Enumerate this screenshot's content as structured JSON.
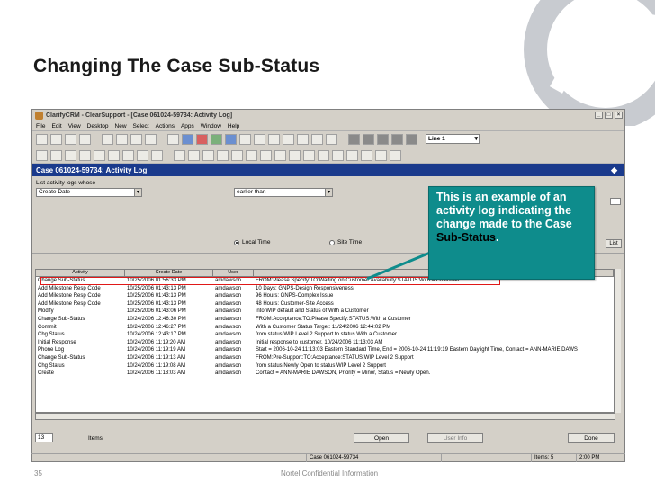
{
  "slide": {
    "title": "Changing The Case Sub-Status",
    "page_number": "35",
    "footer": "Nortel Confidential Information"
  },
  "window": {
    "title": "ClarifyCRM - ClearSupport - [Case 061024-59734: Activity Log]",
    "menu": [
      "File",
      "Edit",
      "View",
      "Desktop",
      "New",
      "Select",
      "Actions",
      "Apps",
      "Window",
      "Help"
    ],
    "line_select": "Line 1"
  },
  "case_header": "Case 061024-59734: Activity Log",
  "form": {
    "list_label": "List activity logs whose",
    "field_value": "Create Date",
    "operator_value": "earlier than",
    "local_time": "Local Time",
    "site_time": "Site Time",
    "list_button": "List"
  },
  "grid": {
    "headers": [
      "Activity",
      "Create Date",
      "User",
      ""
    ],
    "rows": [
      [
        "Change Sub-Status",
        "10/25/2006 01:56:33 PM",
        "amdawson",
        "FROM:Please Specify:TO:Waiting on Customer Availability:STATUS:With a Customer"
      ],
      [
        "Add Milestone Resp Code",
        "10/25/2006 01:43:13 PM",
        "amdawson",
        "10 Days: GNPS-Design Responsiveness"
      ],
      [
        "Add Milestone Resp Code",
        "10/25/2006 01:43:13 PM",
        "amdawson",
        "96 Hours: GNPS-Complex Issue"
      ],
      [
        "Add Milestone Resp Code",
        "10/25/2006 01:43:13 PM",
        "amdawson",
        "48 Hours: Customer-Site Access"
      ],
      [
        "Modify",
        "10/25/2006 01:43:06 PM",
        "amdawson",
        "into WIP default and Status of With a Customer"
      ],
      [
        "Change Sub-Status",
        "10/24/2006 12:46:30 PM",
        "amdawson",
        "FROM:Acceptance:TO:Please Specify:STATUS:With a Customer"
      ],
      [
        "Commit",
        "10/24/2006 12:46:27 PM",
        "amdawson",
        "With a Customer Status Target: 11/24/2006 12:44:02 PM"
      ],
      [
        "Chg Status",
        "10/24/2006 12:43:17 PM",
        "amdawson",
        "from status WIP Level 2 Support to status With a Customer"
      ],
      [
        "Initial Response",
        "10/24/2006 11:19:20 AM",
        "amdawson",
        "Initial response to customer. 10/24/2006 11:13:03 AM"
      ],
      [
        "Phone Log",
        "10/24/2006 11:19:19 AM",
        "amdawson",
        "Start = 2006-10-24 11:13:03 Eastern Standard Time, End = 2006-10-24 11:19:19 Eastern Daylight Time, Contact = ANN-MARIE DAWS"
      ],
      [
        "Change Sub-Status",
        "10/24/2006 11:19:13 AM",
        "amdawson",
        "FROM:Pre-Support:TO:Acceptance:STATUS:WIP Level 2 Support"
      ],
      [
        "Chg Status",
        "10/24/2006 11:19:08 AM",
        "amdawson",
        "from status Newly Open to status WIP Level 2 Support"
      ],
      [
        "Create",
        "10/24/2006 11:13:03 AM",
        "amdawson",
        "Contact = ANN-MARIE DAWSON, Priority = Minor, Status = Newly Open."
      ]
    ]
  },
  "bottom": {
    "items_count": "13",
    "items_label": "Items",
    "open_button": "Open",
    "user_info_button": "User Info",
    "done_button": "Done"
  },
  "statusbar": {
    "case": "Case 061024-59734",
    "items": "Items: 5",
    "time": "2:00 PM"
  },
  "callout": {
    "text": "This is an example of an activity log indicating the change made to the Case",
    "emphasis": "Sub-Status",
    "tail": "."
  },
  "colors": {
    "callout_bg": "#0e8c8c",
    "header_blue": "#1a3a8c",
    "highlight_red": "#e01818"
  }
}
